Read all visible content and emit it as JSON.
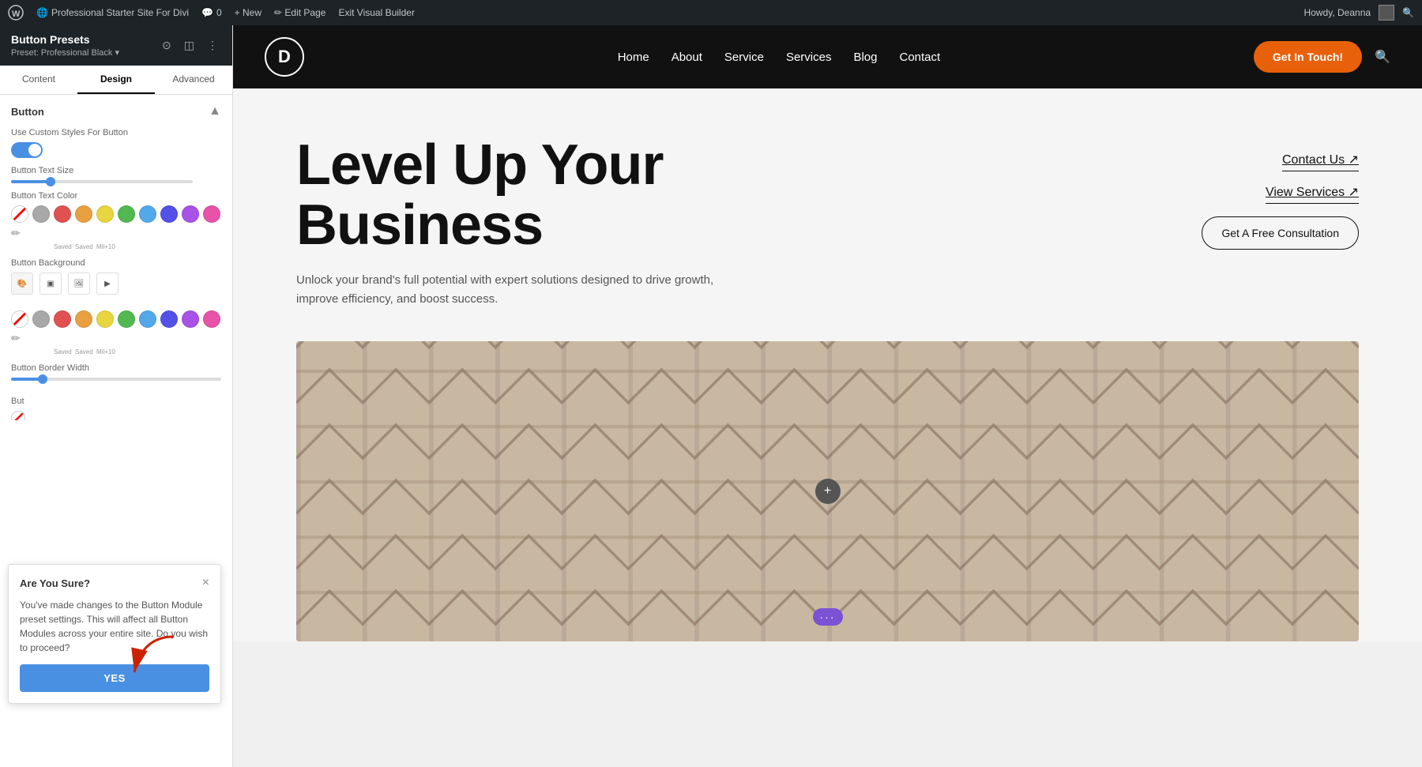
{
  "wp_admin_bar": {
    "wp_icon": "W",
    "site_name": "Professional Starter Site For Divi",
    "comments_icon": "💬",
    "comments_count": "0",
    "new_label": "+ New",
    "edit_page_label": "✏ Edit Page",
    "exit_builder_label": "Exit Visual Builder",
    "howdy_label": "Howdy, Deanna",
    "search_icon": "🔍"
  },
  "left_panel": {
    "title": "Button Presets",
    "subtitle": "Preset: Professional Black ▾",
    "icons": [
      "⊙",
      "◫",
      "⋮"
    ],
    "tabs": [
      "Content",
      "Design",
      "Advanced"
    ],
    "active_tab": "Design",
    "section_title": "Button",
    "section_collapse": "▲",
    "fields": {
      "custom_styles_label": "Use Custom Styles For Button",
      "toggle_state": "on",
      "text_size_label": "Button Text Size",
      "text_size_value": "",
      "text_color_label": "Button Text Color",
      "colors": [
        "transparent",
        "gray",
        "red",
        "orange",
        "yellow",
        "green",
        "teal",
        "blue",
        "purple",
        "pink"
      ],
      "color_labels": [
        "",
        "Saved",
        "Saved",
        "Mil+10",
        ""
      ],
      "bg_label": "Button Background",
      "border_width_label": "Button Border Width",
      "border_width_value": ""
    }
  },
  "dialog": {
    "title": "Are You Sure?",
    "text": "You've made changes to the Button Module preset settings. This will affect all Button Modules across your entire site. Do you wish to proceed?",
    "yes_label": "Yes",
    "close_icon": "×"
  },
  "site_navbar": {
    "logo_letter": "D",
    "nav_items": [
      "Home",
      "About",
      "Service",
      "Services",
      "Blog",
      "Contact"
    ],
    "cta_label": "Get In Touch!",
    "search_icon": "🔍"
  },
  "hero": {
    "title_line1": "Level Up Your",
    "title_line2": "Business",
    "subtitle": "Unlock your brand's full potential with expert solutions designed to drive growth, improve efficiency, and boost success.",
    "contact_link": "Contact Us ↗",
    "services_link": "View Services ↗",
    "consultation_btn": "Get A Free Consultation"
  },
  "image_section": {
    "add_icon": "+",
    "menu_dots": "···"
  },
  "colors": {
    "orange_cta": "#e8610a",
    "dark": "#111111",
    "panel_blue": "#4a90e2",
    "purple_btn": "#7b52d4"
  }
}
